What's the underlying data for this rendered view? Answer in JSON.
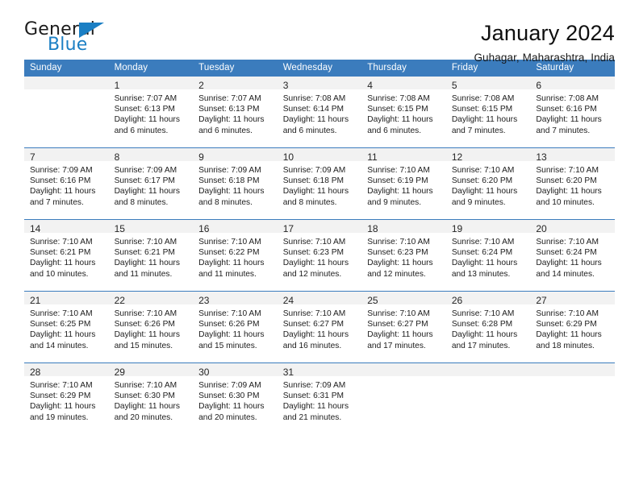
{
  "brand": {
    "name_part1": "General",
    "name_part2": "Blue",
    "accent_color": "#1b7fc4"
  },
  "header": {
    "title": "January 2024",
    "subtitle": "Guhagar, Maharashtra, India"
  },
  "calendar": {
    "header_color": "#3b7cbd",
    "daynum_band_color": "#f2f2f2",
    "weekdays": [
      "Sunday",
      "Monday",
      "Tuesday",
      "Wednesday",
      "Thursday",
      "Friday",
      "Saturday"
    ],
    "weeks": [
      [
        {
          "day": "",
          "sunrise": "",
          "sunset": "",
          "daylight_line1": "",
          "daylight_line2": ""
        },
        {
          "day": "1",
          "sunrise": "Sunrise: 7:07 AM",
          "sunset": "Sunset: 6:13 PM",
          "daylight_line1": "Daylight: 11 hours",
          "daylight_line2": "and 6 minutes."
        },
        {
          "day": "2",
          "sunrise": "Sunrise: 7:07 AM",
          "sunset": "Sunset: 6:13 PM",
          "daylight_line1": "Daylight: 11 hours",
          "daylight_line2": "and 6 minutes."
        },
        {
          "day": "3",
          "sunrise": "Sunrise: 7:08 AM",
          "sunset": "Sunset: 6:14 PM",
          "daylight_line1": "Daylight: 11 hours",
          "daylight_line2": "and 6 minutes."
        },
        {
          "day": "4",
          "sunrise": "Sunrise: 7:08 AM",
          "sunset": "Sunset: 6:15 PM",
          "daylight_line1": "Daylight: 11 hours",
          "daylight_line2": "and 6 minutes."
        },
        {
          "day": "5",
          "sunrise": "Sunrise: 7:08 AM",
          "sunset": "Sunset: 6:15 PM",
          "daylight_line1": "Daylight: 11 hours",
          "daylight_line2": "and 7 minutes."
        },
        {
          "day": "6",
          "sunrise": "Sunrise: 7:08 AM",
          "sunset": "Sunset: 6:16 PM",
          "daylight_line1": "Daylight: 11 hours",
          "daylight_line2": "and 7 minutes."
        }
      ],
      [
        {
          "day": "7",
          "sunrise": "Sunrise: 7:09 AM",
          "sunset": "Sunset: 6:16 PM",
          "daylight_line1": "Daylight: 11 hours",
          "daylight_line2": "and 7 minutes."
        },
        {
          "day": "8",
          "sunrise": "Sunrise: 7:09 AM",
          "sunset": "Sunset: 6:17 PM",
          "daylight_line1": "Daylight: 11 hours",
          "daylight_line2": "and 8 minutes."
        },
        {
          "day": "9",
          "sunrise": "Sunrise: 7:09 AM",
          "sunset": "Sunset: 6:18 PM",
          "daylight_line1": "Daylight: 11 hours",
          "daylight_line2": "and 8 minutes."
        },
        {
          "day": "10",
          "sunrise": "Sunrise: 7:09 AM",
          "sunset": "Sunset: 6:18 PM",
          "daylight_line1": "Daylight: 11 hours",
          "daylight_line2": "and 8 minutes."
        },
        {
          "day": "11",
          "sunrise": "Sunrise: 7:10 AM",
          "sunset": "Sunset: 6:19 PM",
          "daylight_line1": "Daylight: 11 hours",
          "daylight_line2": "and 9 minutes."
        },
        {
          "day": "12",
          "sunrise": "Sunrise: 7:10 AM",
          "sunset": "Sunset: 6:20 PM",
          "daylight_line1": "Daylight: 11 hours",
          "daylight_line2": "and 9 minutes."
        },
        {
          "day": "13",
          "sunrise": "Sunrise: 7:10 AM",
          "sunset": "Sunset: 6:20 PM",
          "daylight_line1": "Daylight: 11 hours",
          "daylight_line2": "and 10 minutes."
        }
      ],
      [
        {
          "day": "14",
          "sunrise": "Sunrise: 7:10 AM",
          "sunset": "Sunset: 6:21 PM",
          "daylight_line1": "Daylight: 11 hours",
          "daylight_line2": "and 10 minutes."
        },
        {
          "day": "15",
          "sunrise": "Sunrise: 7:10 AM",
          "sunset": "Sunset: 6:21 PM",
          "daylight_line1": "Daylight: 11 hours",
          "daylight_line2": "and 11 minutes."
        },
        {
          "day": "16",
          "sunrise": "Sunrise: 7:10 AM",
          "sunset": "Sunset: 6:22 PM",
          "daylight_line1": "Daylight: 11 hours",
          "daylight_line2": "and 11 minutes."
        },
        {
          "day": "17",
          "sunrise": "Sunrise: 7:10 AM",
          "sunset": "Sunset: 6:23 PM",
          "daylight_line1": "Daylight: 11 hours",
          "daylight_line2": "and 12 minutes."
        },
        {
          "day": "18",
          "sunrise": "Sunrise: 7:10 AM",
          "sunset": "Sunset: 6:23 PM",
          "daylight_line1": "Daylight: 11 hours",
          "daylight_line2": "and 12 minutes."
        },
        {
          "day": "19",
          "sunrise": "Sunrise: 7:10 AM",
          "sunset": "Sunset: 6:24 PM",
          "daylight_line1": "Daylight: 11 hours",
          "daylight_line2": "and 13 minutes."
        },
        {
          "day": "20",
          "sunrise": "Sunrise: 7:10 AM",
          "sunset": "Sunset: 6:24 PM",
          "daylight_line1": "Daylight: 11 hours",
          "daylight_line2": "and 14 minutes."
        }
      ],
      [
        {
          "day": "21",
          "sunrise": "Sunrise: 7:10 AM",
          "sunset": "Sunset: 6:25 PM",
          "daylight_line1": "Daylight: 11 hours",
          "daylight_line2": "and 14 minutes."
        },
        {
          "day": "22",
          "sunrise": "Sunrise: 7:10 AM",
          "sunset": "Sunset: 6:26 PM",
          "daylight_line1": "Daylight: 11 hours",
          "daylight_line2": "and 15 minutes."
        },
        {
          "day": "23",
          "sunrise": "Sunrise: 7:10 AM",
          "sunset": "Sunset: 6:26 PM",
          "daylight_line1": "Daylight: 11 hours",
          "daylight_line2": "and 15 minutes."
        },
        {
          "day": "24",
          "sunrise": "Sunrise: 7:10 AM",
          "sunset": "Sunset: 6:27 PM",
          "daylight_line1": "Daylight: 11 hours",
          "daylight_line2": "and 16 minutes."
        },
        {
          "day": "25",
          "sunrise": "Sunrise: 7:10 AM",
          "sunset": "Sunset: 6:27 PM",
          "daylight_line1": "Daylight: 11 hours",
          "daylight_line2": "and 17 minutes."
        },
        {
          "day": "26",
          "sunrise": "Sunrise: 7:10 AM",
          "sunset": "Sunset: 6:28 PM",
          "daylight_line1": "Daylight: 11 hours",
          "daylight_line2": "and 17 minutes."
        },
        {
          "day": "27",
          "sunrise": "Sunrise: 7:10 AM",
          "sunset": "Sunset: 6:29 PM",
          "daylight_line1": "Daylight: 11 hours",
          "daylight_line2": "and 18 minutes."
        }
      ],
      [
        {
          "day": "28",
          "sunrise": "Sunrise: 7:10 AM",
          "sunset": "Sunset: 6:29 PM",
          "daylight_line1": "Daylight: 11 hours",
          "daylight_line2": "and 19 minutes."
        },
        {
          "day": "29",
          "sunrise": "Sunrise: 7:10 AM",
          "sunset": "Sunset: 6:30 PM",
          "daylight_line1": "Daylight: 11 hours",
          "daylight_line2": "and 20 minutes."
        },
        {
          "day": "30",
          "sunrise": "Sunrise: 7:09 AM",
          "sunset": "Sunset: 6:30 PM",
          "daylight_line1": "Daylight: 11 hours",
          "daylight_line2": "and 20 minutes."
        },
        {
          "day": "31",
          "sunrise": "Sunrise: 7:09 AM",
          "sunset": "Sunset: 6:31 PM",
          "daylight_line1": "Daylight: 11 hours",
          "daylight_line2": "and 21 minutes."
        },
        {
          "day": "",
          "sunrise": "",
          "sunset": "",
          "daylight_line1": "",
          "daylight_line2": ""
        },
        {
          "day": "",
          "sunrise": "",
          "sunset": "",
          "daylight_line1": "",
          "daylight_line2": ""
        },
        {
          "day": "",
          "sunrise": "",
          "sunset": "",
          "daylight_line1": "",
          "daylight_line2": ""
        }
      ]
    ]
  }
}
